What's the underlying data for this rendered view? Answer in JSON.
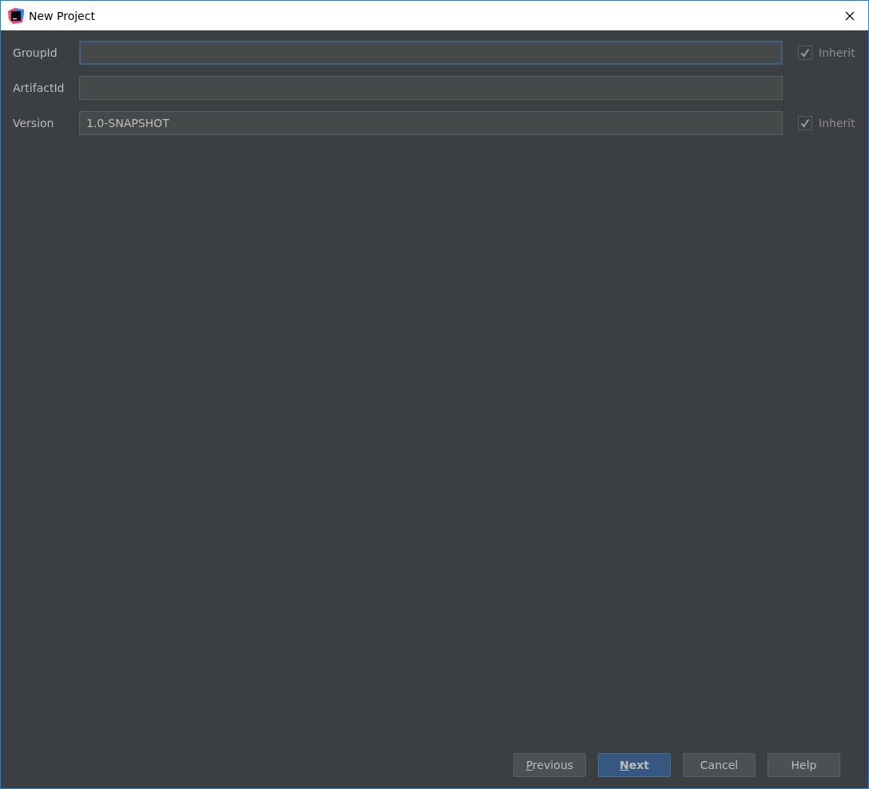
{
  "window": {
    "title": "New Project"
  },
  "fields": [
    {
      "label": "GroupId",
      "focused": true,
      "inherit": {
        "label": "Inherit",
        "checked": true,
        "disabled": true
      }
    },
    {
      "label": "ArtifactId",
      "focused": false
    },
    {
      "label": "Version",
      "value": "1.0-SNAPSHOT",
      "focused": false,
      "inherit": {
        "label": "Inherit",
        "checked": true,
        "disabled": true
      }
    }
  ],
  "buttons": [
    {
      "label": "Previous",
      "mnemonic": true,
      "primary": false
    },
    {
      "label": "Next",
      "mnemonic": true,
      "primary": true
    },
    {
      "label": "Cancel",
      "mnemonic": false,
      "primary": false
    },
    {
      "label": "Help",
      "mnemonic": false,
      "primary": false
    }
  ]
}
